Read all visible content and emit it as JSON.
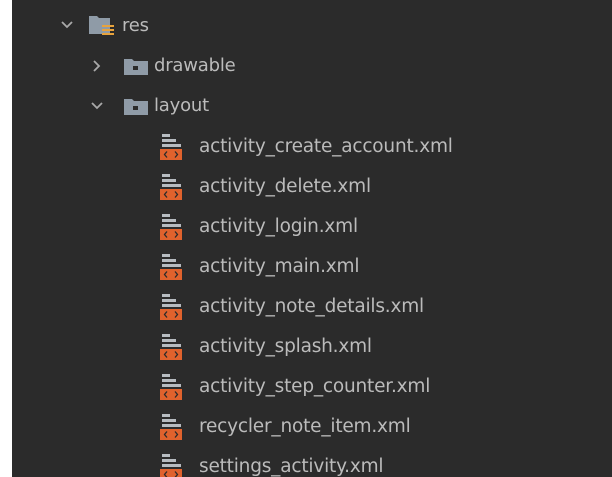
{
  "project_tree": {
    "res": {
      "label": "res",
      "expanded": true,
      "icon": "resource-folder-icon"
    },
    "drawable": {
      "label": "drawable",
      "expanded": false,
      "icon": "folder-icon"
    },
    "layout": {
      "label": "layout",
      "expanded": true,
      "icon": "folder-icon",
      "files": [
        {
          "label": "activity_create_account.xml",
          "icon": "layout-xml-file-icon"
        },
        {
          "label": "activity_delete.xml",
          "icon": "layout-xml-file-icon"
        },
        {
          "label": "activity_login.xml",
          "icon": "layout-xml-file-icon"
        },
        {
          "label": "activity_main.xml",
          "icon": "layout-xml-file-icon"
        },
        {
          "label": "activity_note_details.xml",
          "icon": "layout-xml-file-icon"
        },
        {
          "label": "activity_splash.xml",
          "icon": "layout-xml-file-icon"
        },
        {
          "label": "activity_step_counter.xml",
          "icon": "layout-xml-file-icon"
        },
        {
          "label": "recycler_note_item.xml",
          "icon": "layout-xml-file-icon"
        },
        {
          "label": "settings_activity.xml",
          "icon": "layout-xml-file-icon"
        }
      ]
    }
  },
  "colors": {
    "panel_background": "#2b2b2b",
    "text": "#bbbbbb",
    "folder_icon": "#8f9ba7",
    "xml_icon_orange": "#e0622d"
  }
}
